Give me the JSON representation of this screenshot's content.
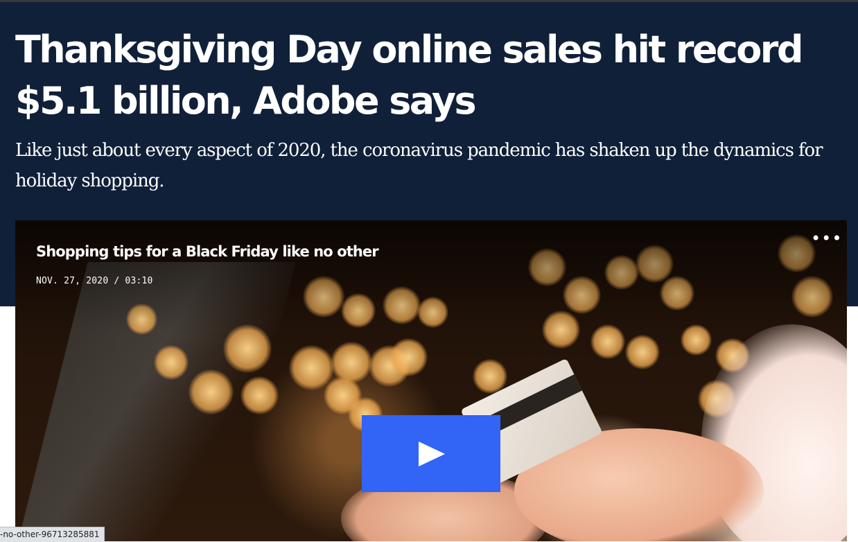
{
  "article": {
    "headline": "Thanksgiving Day online sales hit record $5.1 billion, Adobe says",
    "dek": "Like just about every aspect of 2020, the coronavirus pandemic has shaken up the dynamics for holiday shopping."
  },
  "video": {
    "title": "Shopping tips for a Black Friday like no other",
    "meta": "NOV. 27, 2020 / 03:10",
    "more_label": "•••",
    "play_icon": "play-icon",
    "play_color": "#3264f6"
  },
  "status_bar": {
    "url_fragment": "-no-other-96713285881"
  },
  "colors": {
    "header_bg": "#102039",
    "text": "#ffffff"
  }
}
